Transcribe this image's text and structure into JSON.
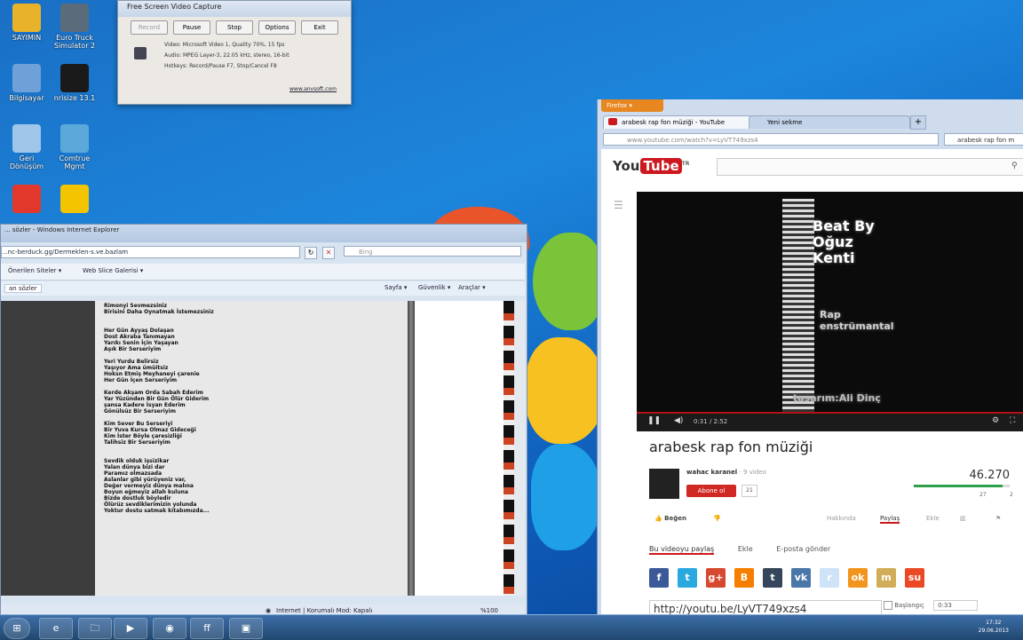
{
  "desktop": {
    "icons": [
      {
        "label": "SAYIMIN",
        "color": "#e8b32a"
      },
      {
        "label": "Euro Truck Simulator 2",
        "color": "#5a6b7c"
      },
      {
        "label": "Bilgisayar",
        "color": "#6fa0d8"
      },
      {
        "label": "nrisize 13.1",
        "color": "#1a1a1a"
      },
      {
        "label": "Geri Dönüşüm",
        "color": "#9fc6e8"
      },
      {
        "label": "Comtrue Mgmt",
        "color": "#5aa9d9"
      },
      {
        "label": "",
        "color": "#e2372b"
      },
      {
        "label": "",
        "color": "#f4c400"
      }
    ]
  },
  "capture_window": {
    "title": "Free Screen Video Capture",
    "buttons": [
      "Record",
      "Pause",
      "Stop",
      "Options",
      "Exit"
    ],
    "video_info": "Video: Microsoft Video 1, Quality 70%, 15 fps",
    "audio_info": "Audio: MPEG Layer-3, 22.05 kHz, stereo, 16-bit",
    "hotkeys_info": "Hotkeys: Record/Pause F7, Stop/Cancel F8",
    "link": "www.anvsoft.com"
  },
  "ie_window": {
    "title": "... sözler - Windows Internet Explorer",
    "address": "...nc-berduck.gg/Dermeklen-s.ve.bazlam",
    "search_placeholder": "Bing",
    "fav_items": [
      "Önerilen Siteler ▾",
      "Web Slice Galerisi ▾"
    ],
    "tab_label": "an sözler",
    "cmd_items": [
      "Sayfa ▾",
      "Güvenlik ▾",
      "Araçlar ▾"
    ],
    "status_text": "Internet | Korumalı Mod: Kapalı",
    "zoom": "%100",
    "lyrics": [
      "Rimonyi Sevmezsiniz",
      "Birisini Daha Oynatmak İstemezsiniz",
      "",
      "",
      "Her Gün Ayyaş Dolaşan",
      "Dost Akraba Tanımayan",
      "Yarıkı Senin İçin Yaşayan",
      "Aşık Bir Serseriyim",
      "",
      "Yeri Yurdu Belirsiz",
      "Yaşıyor Ama ümüitsiz",
      "Hoksn Etmiş Meyhaneyi çarenie",
      "Her Gün İçen Serseriyim",
      "",
      "Kerde Akşam Orda Sabah Ederim",
      "Yar Yüzünden Bir Gün Ölür Giderim",
      "şansa Kadere İsyan Ederim",
      "Gönülsüz Bir Serseriyim",
      "",
      "Kim Sever Bu Serseriyi",
      "Bir Yuva Kursa Olmaz Gideceği",
      "Kim İster Böyle çaresizliği",
      "Talihsiz Bir Serseriyim",
      "",
      "",
      "Sevdik olduk işsizikar",
      "Yalan dünya bizi dar",
      "Paramız olmazsada",
      "Aslanlar gibi yürüyeniz var,",
      "Değer vermeyiz dünya malına",
      "Boyun eğmeyiz allah kuluna",
      "Bizde dostluk böyledir",
      "Ölürüz sevdiklerimizin yolunda",
      "Yoktur dostu satmak kitabımızda..."
    ]
  },
  "firefox": {
    "menu_button": "Firefox ▾",
    "tabs": [
      "arabesk rap fon müziği - YouTube",
      "Yeni sekme"
    ],
    "new_tab": "+",
    "url": "www.youtube.com/watch?v=LyVT749xzs4",
    "search_text": "arabesk rap fon m"
  },
  "youtube": {
    "logo_text": "You",
    "logo_box": "Tube",
    "logo_suffix": "TR",
    "video_overlay_top": "Beat By Oğuz Kenti",
    "video_overlay_mid": "Rap enstrümantal",
    "video_overlay_bottom": "tasarım:Ali Dinç",
    "time": "0:31 / 2:52",
    "video_title": "arabesk rap fon müziği",
    "channel_name": "wahac karanel",
    "channel_videos": "· 9 video",
    "subscribe": "Abone ol",
    "sub_count": "21",
    "views": "46.270",
    "likes": "27",
    "dislikes": "2",
    "like_ratio": 0.93,
    "like_label": "Beğen",
    "action_tabs": [
      "Hakkında",
      "Paylaş",
      "Ekle",
      "İstatistikler",
      "Bildir"
    ],
    "share_tabs": [
      "Bu videoyu paylaş",
      "Ekle",
      "E-posta gönder"
    ],
    "share_icons": [
      {
        "name": "facebook",
        "color": "#3b5998",
        "glyph": "f"
      },
      {
        "name": "twitter",
        "color": "#2aa9e0",
        "glyph": "t"
      },
      {
        "name": "googleplus",
        "color": "#d6492f",
        "glyph": "g+"
      },
      {
        "name": "blogger",
        "color": "#f57d00",
        "glyph": "B"
      },
      {
        "name": "tumblr",
        "color": "#35465c",
        "glyph": "t"
      },
      {
        "name": "vk",
        "color": "#4a76a8",
        "glyph": "vk"
      },
      {
        "name": "reddit",
        "color": "#cee3f8",
        "glyph": "r"
      },
      {
        "name": "odnoklassniki",
        "color": "#f2951f",
        "glyph": "ok"
      },
      {
        "name": "mixi",
        "color": "#d1ad59",
        "glyph": "m"
      },
      {
        "name": "stumbleupon",
        "color": "#eb4924",
        "glyph": "su"
      }
    ],
    "share_url": "http://youtu.be/LyVT749xzs4",
    "start_label": "Başlangıç",
    "start_time": "0:33"
  },
  "taskbar": {
    "items": [
      "⊞",
      "e",
      "🗀",
      "▶",
      "◉",
      "ff",
      "▣"
    ],
    "clock_time": "17:32",
    "clock_date": "29.06.2013"
  },
  "colors": {
    "desktop": "#1a78d0",
    "youtube_red": "#cc181e",
    "firefox_orange": "#e88620",
    "like_green": "#2ea04b"
  }
}
